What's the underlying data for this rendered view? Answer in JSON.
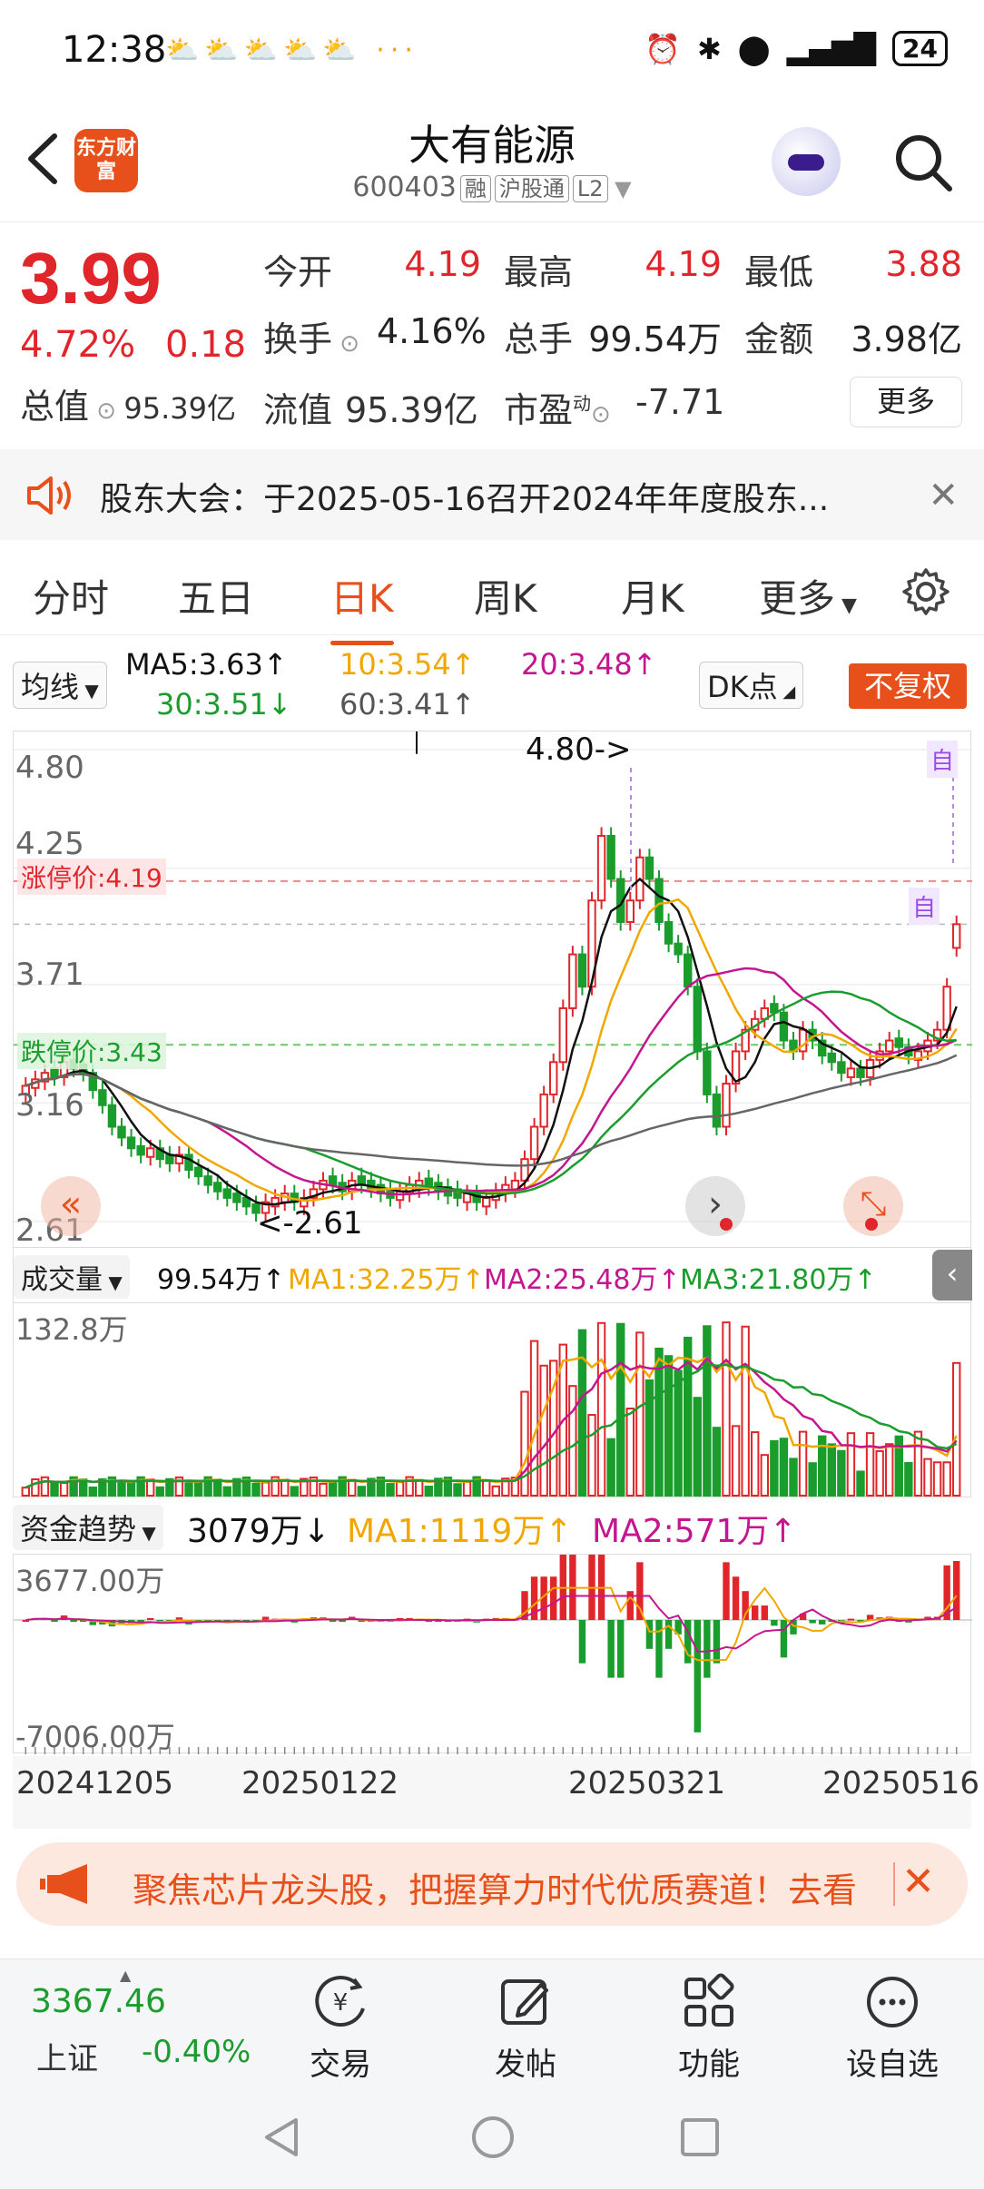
{
  "status": {
    "time": "12:38",
    "notif_icons": "⛅⛅⛅⛅⛅ ···",
    "battery": "24"
  },
  "header": {
    "logo_text": "东方财富",
    "title": "大有能源",
    "code": "600403",
    "tags": [
      "融",
      "沪股通",
      "L2"
    ]
  },
  "quote": {
    "price": "3.99",
    "pct": "4.72%",
    "change": "0.18",
    "open_label": "今开",
    "open": "4.19",
    "high_label": "最高",
    "high": "4.19",
    "low_label": "最低",
    "low": "3.88",
    "turnover_label": "换手",
    "turnover": "4.16%",
    "volume_label": "总手",
    "volume": "99.54万",
    "amount_label": "金额",
    "amount": "3.98亿",
    "mktcap_label": "总值",
    "mktcap": "95.39亿",
    "float_label": "流值",
    "float": "95.39亿",
    "pe_label": "市盈",
    "pe_sup": "动",
    "pe": "-7.71",
    "more": "更多"
  },
  "notice": {
    "text": "股东大会：于2025-05-16召开2024年年度股东..."
  },
  "tabs": [
    "分时",
    "五日",
    "日K",
    "周K",
    "月K",
    "更多"
  ],
  "legend": {
    "ma_select": "均线",
    "ma5": "MA5:3.63↑",
    "ma10": "10:3.54↑",
    "ma20": "20:3.48↑",
    "ma30": "30:3.51↓",
    "ma60": "60:3.41↑",
    "dk": "DK点",
    "fuquan": "不复权"
  },
  "chart_data": {
    "type": "candlestick",
    "ytick_labels": [
      "4.80",
      "4.25",
      "3.71",
      "3.16",
      "2.61"
    ],
    "ylim": [
      2.61,
      4.8
    ],
    "limit_up_label": "涨停价:4.19",
    "limit_up": 4.19,
    "limit_down_label": "跌停价:3.43",
    "limit_down": 3.43,
    "max_annotation": "4.80->",
    "min_annotation": "<-2.61",
    "self_marker": "自",
    "x_dates": [
      "20241205",
      "20250122",
      "20250321",
      "20250516"
    ],
    "candles_close": [
      3.24,
      3.27,
      3.3,
      3.28,
      3.35,
      3.32,
      3.3,
      3.22,
      3.15,
      3.05,
      3.0,
      2.95,
      2.92,
      2.95,
      2.9,
      2.88,
      2.92,
      2.85,
      2.82,
      2.78,
      2.75,
      2.72,
      2.7,
      2.68,
      2.65,
      2.7,
      2.72,
      2.74,
      2.7,
      2.72,
      2.76,
      2.8,
      2.78,
      2.75,
      2.8,
      2.78,
      2.76,
      2.74,
      2.72,
      2.75,
      2.78,
      2.8,
      2.77,
      2.75,
      2.73,
      2.72,
      2.74,
      2.7,
      2.72,
      2.75,
      2.78,
      2.8,
      2.9,
      3.05,
      3.2,
      3.35,
      3.6,
      3.85,
      3.7,
      4.1,
      4.4,
      4.2,
      4.0,
      4.1,
      4.3,
      4.2,
      4.0,
      3.9,
      3.85,
      3.7,
      3.4,
      3.2,
      3.05,
      3.25,
      3.4,
      3.5,
      3.55,
      3.6,
      3.58,
      3.45,
      3.4,
      3.5,
      3.45,
      3.38,
      3.35,
      3.3,
      3.32,
      3.28,
      3.36,
      3.4,
      3.45,
      3.42,
      3.38,
      3.4,
      3.45,
      3.5,
      3.7,
      3.99
    ],
    "candles_up": [
      1,
      1,
      1,
      0,
      1,
      0,
      0,
      0,
      0,
      0,
      0,
      0,
      0,
      1,
      0,
      0,
      1,
      0,
      0,
      0,
      0,
      0,
      0,
      0,
      0,
      1,
      1,
      1,
      0,
      1,
      1,
      1,
      0,
      0,
      1,
      0,
      0,
      0,
      0,
      1,
      1,
      1,
      0,
      0,
      0,
      0,
      1,
      0,
      1,
      1,
      1,
      1,
      1,
      1,
      1,
      1,
      1,
      1,
      0,
      1,
      1,
      0,
      0,
      1,
      1,
      0,
      0,
      0,
      0,
      0,
      0,
      0,
      0,
      1,
      1,
      1,
      1,
      1,
      0,
      0,
      0,
      1,
      0,
      0,
      0,
      0,
      1,
      0,
      1,
      1,
      1,
      0,
      0,
      1,
      1,
      1,
      1,
      1
    ],
    "volume_label": "成交量",
    "volume_value": "99.54万↑",
    "vol_ma1": "MA1:32.25万↑",
    "vol_ma2": "MA2:25.48万↑",
    "vol_ma3": "MA3:21.80万↑",
    "vol_max_label": "132.8万",
    "fund_label": "资金趋势",
    "fund_value": "3079万↓",
    "fund_ma1": "MA1:1119万↑",
    "fund_ma2": "MA2:571万↑",
    "fund_max_label": "3677.00万",
    "fund_min_label": "-7006.00万"
  },
  "banner": {
    "text": "聚焦芯片龙头股，把握算力时代优质赛道！去看"
  },
  "bottom": {
    "index_value": "3367.46",
    "index_name": "上证",
    "index_change": "-0.40%",
    "items": [
      "交易",
      "发帖",
      "功能",
      "设自选"
    ]
  },
  "colors": {
    "up": "#e0262b",
    "down": "#1a9d2c",
    "accent": "#e8501b",
    "ma5": "#111111",
    "ma10": "#f0a800",
    "ma20": "#c4168f",
    "ma30": "#1a9d2c",
    "ma60": "#666666"
  }
}
